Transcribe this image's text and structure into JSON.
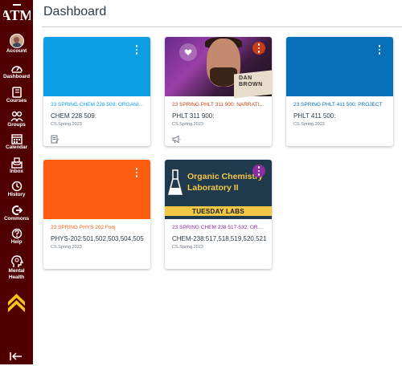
{
  "page": {
    "title": "Dashboard"
  },
  "global_nav": {
    "logo_text": "ATM",
    "items": [
      {
        "label": "Account",
        "icon": "avatar"
      },
      {
        "label": "Dashboard",
        "icon": "speedometer-icon"
      },
      {
        "label": "Courses",
        "icon": "book-icon"
      },
      {
        "label": "Groups",
        "icon": "users-icon"
      },
      {
        "label": "Calendar",
        "icon": "calendar-icon"
      },
      {
        "label": "Inbox",
        "icon": "inbox-icon"
      },
      {
        "label": "History",
        "icon": "clock-icon"
      },
      {
        "label": "Commons",
        "icon": "commons-icon"
      },
      {
        "label": "Help",
        "icon": "help-icon"
      },
      {
        "label_line1": "Mental",
        "label_line2": "Health",
        "icon": "head-brain-icon"
      }
    ],
    "colors": {
      "background": "#500000",
      "chevron": "#f7c51c",
      "text": "#ffffff"
    }
  },
  "cards": [
    {
      "name": "23 SPRING CHEM 228 509: ORGANIC CHEMISTRY",
      "code": "CHEM 228 509:",
      "term": "CS.Spring.2023",
      "color": "#0d9ee6",
      "hero": "color",
      "action_icon": "assignment-icon"
    },
    {
      "name": "23 SPRING PHLT 311 900: NARRATIVES",
      "code": "PHLT 311 900:",
      "term": "CS.Spring.2023",
      "color": "#c63d17",
      "hero": "photo",
      "photo_book_text_1": "DAN",
      "photo_book_text_2": "BROWN",
      "action_icon": "announcement-icon"
    },
    {
      "name": "23 SPRING PHLT 411 500: PROJECT",
      "code": "PHLT 411 500:",
      "term": "CS.Spring.2023",
      "color": "#0770b8",
      "hero": "color"
    },
    {
      "name": "23 SPRING PHYS 202 Fonj",
      "code": "PHYS-202:501,502,503,504,505",
      "term": "CS.Spring.2023",
      "color": "#fd5d10",
      "hero": "color"
    },
    {
      "name": "23 SPRING CHEM 238 517-532: ORGANIC",
      "code": "CHEM-238:517,518,519,520,521",
      "term": "CS.Spring.2023",
      "color": "#8d2da3",
      "hero": "chem",
      "hero_title_1": "Organic Chemistry",
      "hero_title_2": "Laboratory II",
      "hero_band": "TUESDAY LABS"
    }
  ]
}
